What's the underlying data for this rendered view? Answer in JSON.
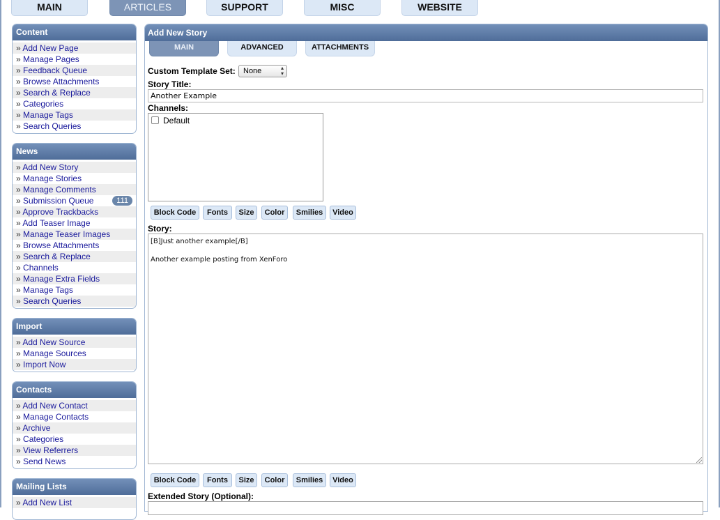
{
  "topnav": {
    "tabs": [
      {
        "label": "MAIN"
      },
      {
        "label": "ARTICLES"
      },
      {
        "label": "SUPPORT"
      },
      {
        "label": "MISC"
      },
      {
        "label": "WEBSITE"
      }
    ],
    "active": "ARTICLES"
  },
  "sidebar": {
    "content": {
      "title": "Content",
      "items": [
        "Add New Page",
        "Manage Pages",
        "Feedback Queue",
        "Browse Attachments",
        "Search & Replace",
        "Categories",
        "Manage Tags",
        "Search Queries"
      ]
    },
    "news": {
      "title": "News",
      "items": [
        "Add New Story",
        "Manage Stories",
        "Manage Comments",
        "Submission Queue",
        "Approve Trackbacks",
        "Add Teaser Image",
        "Manage Teaser Images",
        "Browse Attachments",
        "Search & Replace",
        "Channels",
        "Manage Extra Fields",
        "Manage Tags",
        "Search Queries"
      ],
      "submission_queue_count": "111"
    },
    "import": {
      "title": "Import",
      "items": [
        "Add New Source",
        "Manage Sources",
        "Import Now"
      ]
    },
    "contacts": {
      "title": "Contacts",
      "items": [
        "Add New Contact",
        "Manage Contacts",
        "Archive",
        "Categories",
        "View Referrers",
        "Send News"
      ]
    },
    "mailing": {
      "title": "Mailing Lists",
      "items": [
        "Add New List"
      ]
    },
    "bullet": "»"
  },
  "panel": {
    "title": "Add New Story",
    "subtabs": [
      "MAIN",
      "ADVANCED",
      "ATTACHMENTS"
    ],
    "template_label": "Custom Template Set:",
    "template_value": "None",
    "story_title_label": "Story Title:",
    "story_title_value": "Another Example",
    "channels_label": "Channels:",
    "channels": [
      "Default"
    ],
    "toolbar": [
      "Block Code",
      "Fonts",
      "Size",
      "Color",
      "Smilies",
      "Video"
    ],
    "story_label": "Story:",
    "story_lines": [
      "[B]Just another example[/B]",
      "",
      "Another example posting from XenForo"
    ],
    "extended_label": "Extended Story (Optional):"
  },
  "colors": {
    "header_gradient_top": "#7390b9",
    "header_gradient_bottom": "#4f6d99",
    "tab_bg": "#dce8f6",
    "tab_active_bg": "#7d94b6",
    "link": "#1a1a9c"
  },
  "icons": {
    "select_arrows": "updown-arrows-icon",
    "resize_grip": "resize-grip-icon"
  }
}
